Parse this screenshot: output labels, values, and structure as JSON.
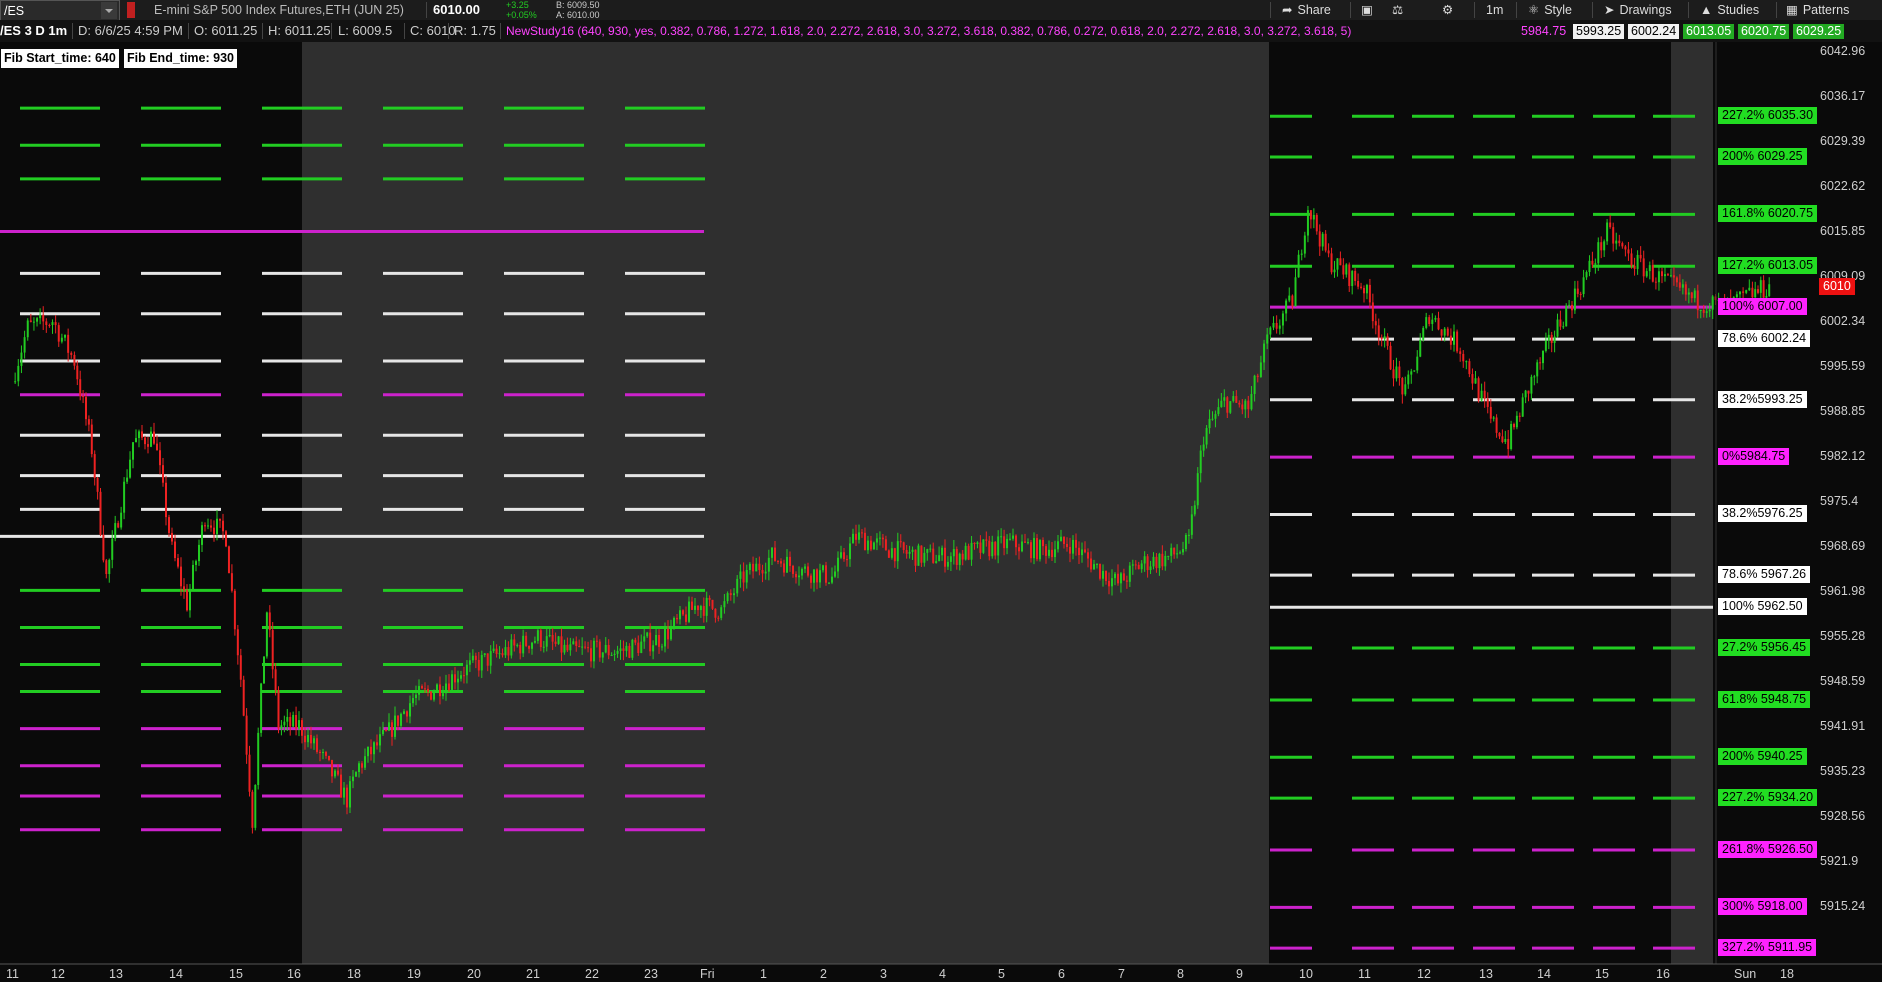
{
  "header": {
    "symbol": "/ES",
    "description": "E-mini S&P 500 Index Futures,ETH (JUN 25)",
    "last_price": "6010.00",
    "change": "+3.25",
    "change_pct": "+0.05%",
    "bid": "B: 6009.50",
    "ask": "A: 6010.00",
    "share_label": "Share",
    "timeframe_label": "1m",
    "style_label": "Style",
    "drawings_label": "Drawings",
    "studies_label": "Studies",
    "patterns_label": "Patterns"
  },
  "ohlc": {
    "title": "/ES 3 D 1m",
    "date": "D: 6/6/25 4:59 PM",
    "open": "O: 6011.25",
    "high": "H: 6011.25",
    "low": "L: 6009.5",
    "close": "C: 6010",
    "range": "R: 1.75"
  },
  "study": {
    "text": "NewStudy16 (640, 930, yes, 0.382, 0.786, 1.272, 1.618, 2.0, 2.272, 2.618, 3.0, 3.272, 3.618, 0.382, 0.786, 0.272, 0.618, 2.0, 2.272, 2.618, 3.0, 3.272, 3.618, 5)",
    "values": [
      "5984.75",
      "5993.25",
      "6002.24",
      "6013.05",
      "6020.75",
      "6029.25"
    ],
    "value_colors": [
      "#ff44ff",
      "#ffffff",
      "#ffffff",
      "#22dd22",
      "#22dd22",
      "#22dd22"
    ],
    "more": "..."
  },
  "fib_tags": {
    "start": "Fib Start_time: 640",
    "end": "Fib End_time: 930"
  },
  "colors": {
    "up": "#22cc22",
    "down": "#ee2222",
    "green_line": "#22cc22",
    "white_line": "#e6e6e6",
    "magenta_line": "#cc22cc",
    "session_bg": "#2f2f2f",
    "current_price": "#ee1111"
  },
  "chart_data": {
    "type": "candlestick",
    "title": "/ES 3 D 1m",
    "y_axis_ticks": [
      "6042.96",
      "6036.17",
      "6029.39",
      "6022.62",
      "6015.85",
      "6009.09",
      "6002.34",
      "5995.59",
      "5988.85",
      "5982.12",
      "5975.4",
      "5968.69",
      "5961.98",
      "5955.28",
      "5948.59",
      "5941.91",
      "5935.23",
      "5928.56",
      "5921.9",
      "5915.24"
    ],
    "ylim": [
      5909.6,
      6046.3
    ],
    "x_axis_ticks": [
      "11",
      "12",
      "13",
      "14",
      "15",
      "16",
      "18",
      "19",
      "20",
      "21",
      "22",
      "23",
      "Fri",
      "1",
      "2",
      "3",
      "4",
      "5",
      "6",
      "7",
      "8",
      "9",
      "10",
      "11",
      "12",
      "13",
      "14",
      "15",
      "16",
      "Sun",
      "18"
    ],
    "current_price": "6010",
    "price_path": [
      [
        0,
        5996
      ],
      [
        0.35,
        6004
      ],
      [
        0.9,
        6005
      ],
      [
        1.3,
        5999
      ],
      [
        1.6,
        5986
      ],
      [
        1.85,
        5967
      ],
      [
        2.3,
        5987
      ],
      [
        2.65,
        5988
      ],
      [
        2.95,
        5971
      ],
      [
        3.2,
        5963
      ],
      [
        3.5,
        5976
      ],
      [
        3.85,
        5973
      ],
      [
        4.1,
        5952
      ],
      [
        4.3,
        5931
      ],
      [
        4.55,
        5962
      ],
      [
        4.75,
        5945
      ],
      [
        5.1,
        5945
      ],
      [
        5.5,
        5940
      ],
      [
        5.9,
        5934
      ],
      [
        6.1,
        5939
      ],
      [
        6.6,
        5944
      ],
      [
        7.0,
        5949
      ],
      [
        7.3,
        5950
      ],
      [
        7.8,
        5953
      ],
      [
        8.3,
        5955
      ],
      [
        9.1,
        5958
      ],
      [
        9.6,
        5956
      ],
      [
        10.5,
        5956
      ],
      [
        11.2,
        5958
      ],
      [
        11.8,
        5963
      ],
      [
        12.2,
        5962
      ],
      [
        12.6,
        5967
      ],
      [
        13.1,
        5970
      ],
      [
        13.6,
        5968
      ],
      [
        14.1,
        5967
      ],
      [
        14.5,
        5973
      ],
      [
        15.1,
        5971
      ],
      [
        15.6,
        5970
      ],
      [
        16.1,
        5970
      ],
      [
        16.6,
        5971
      ],
      [
        17.1,
        5972
      ],
      [
        17.6,
        5971
      ],
      [
        18.1,
        5972
      ],
      [
        18.6,
        5968
      ],
      [
        18.9,
        5966
      ],
      [
        19.3,
        5969
      ],
      [
        19.8,
        5970
      ],
      [
        20.1,
        5972
      ],
      [
        20.35,
        5988
      ],
      [
        20.7,
        5993
      ],
      [
        21.1,
        5992
      ],
      [
        21.4,
        6002
      ],
      [
        21.8,
        6008
      ],
      [
        22.05,
        6022
      ],
      [
        22.4,
        6014
      ],
      [
        22.7,
        6012
      ],
      [
        23.0,
        6010
      ],
      [
        23.4,
        6000
      ],
      [
        23.7,
        5994
      ],
      [
        24.1,
        6006
      ],
      [
        24.6,
        6001
      ],
      [
        25.1,
        5990
      ],
      [
        25.4,
        5987
      ],
      [
        25.8,
        5996
      ],
      [
        26.3,
        6005
      ],
      [
        26.7,
        6011
      ],
      [
        27.1,
        6018
      ],
      [
        27.5,
        6014
      ],
      [
        28.0,
        6011
      ],
      [
        28.4,
        6008
      ],
      [
        28.8,
        6007
      ],
      [
        29.2,
        6009
      ],
      [
        29.6,
        6010
      ]
    ],
    "fib_levels": [
      {
        "label": "227.2% 6035.30",
        "price": 6035.3,
        "kind": "green"
      },
      {
        "label": "200% 6029.25",
        "price": 6029.25,
        "kind": "green"
      },
      {
        "label": "161.8% 6020.75",
        "price": 6020.75,
        "kind": "green"
      },
      {
        "label": "127.2% 6013.05",
        "price": 6013.05,
        "kind": "green"
      },
      {
        "label": "100% 6007.00",
        "price": 6007.0,
        "kind": "magenta"
      },
      {
        "label": "78.6% 6002.24",
        "price": 6002.24,
        "kind": "white"
      },
      {
        "label": "38.2%5993.25",
        "price": 5993.25,
        "kind": "white"
      },
      {
        "label": "0%5984.75",
        "price": 5984.75,
        "kind": "magenta"
      },
      {
        "label": "38.2%5976.25",
        "price": 5976.25,
        "kind": "white"
      },
      {
        "label": "78.6% 5967.26",
        "price": 5967.26,
        "kind": "white"
      },
      {
        "label": "100% 5962.50",
        "price": 5962.5,
        "kind": "white"
      },
      {
        "label": "27.2% 5956.45",
        "price": 5956.45,
        "kind": "green"
      },
      {
        "label": "61.8% 5948.75",
        "price": 5948.75,
        "kind": "green"
      },
      {
        "label": "200% 5940.25",
        "price": 5940.25,
        "kind": "green"
      },
      {
        "label": "227.2% 5934.20",
        "price": 5934.2,
        "kind": "green"
      },
      {
        "label": "261.8% 5926.50",
        "price": 5926.5,
        "kind": "magenta"
      },
      {
        "label": "300% 5918.00",
        "price": 5918.0,
        "kind": "magenta"
      },
      {
        "label": "327.2% 5911.95",
        "price": 5911.95,
        "kind": "magenta"
      }
    ],
    "prior_day_levels": [
      {
        "price": 6036.5,
        "kind": "green"
      },
      {
        "price": 6031.0,
        "kind": "green"
      },
      {
        "price": 6026.0,
        "kind": "green"
      },
      {
        "price": 6018.2,
        "kind": "magenta",
        "solid": true
      },
      {
        "price": 6012.0,
        "kind": "white"
      },
      {
        "price": 6006.0,
        "kind": "white"
      },
      {
        "price": 5999.0,
        "kind": "white"
      },
      {
        "price": 5994.0,
        "kind": "magenta"
      },
      {
        "price": 5988.0,
        "kind": "white"
      },
      {
        "price": 5982.0,
        "kind": "white"
      },
      {
        "price": 5977.0,
        "kind": "white"
      },
      {
        "price": 5973.0,
        "kind": "white",
        "solid": true
      },
      {
        "price": 5965.0,
        "kind": "green"
      },
      {
        "price": 5959.5,
        "kind": "green"
      },
      {
        "price": 5954.0,
        "kind": "green"
      },
      {
        "price": 5950.0,
        "kind": "green"
      },
      {
        "price": 5944.5,
        "kind": "magenta"
      },
      {
        "price": 5939.0,
        "kind": "magenta"
      },
      {
        "price": 5934.5,
        "kind": "magenta"
      },
      {
        "price": 5929.5,
        "kind": "magenta"
      }
    ]
  }
}
